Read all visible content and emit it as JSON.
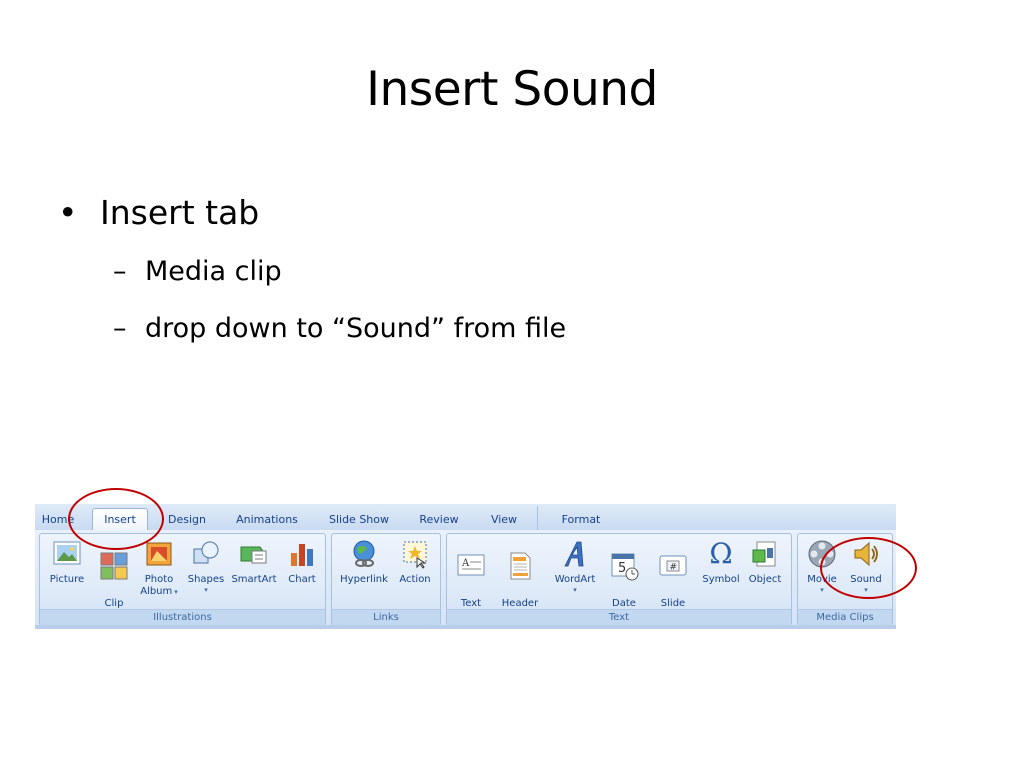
{
  "slide": {
    "title": "Insert Sound",
    "bullet": "Insert tab",
    "sub_bullets": [
      "Media clip",
      "drop down to “Sound” from file"
    ],
    "bullet_glyph": "•",
    "sub_glyph": "–"
  },
  "ribbon": {
    "tabs": [
      "Home",
      "Insert",
      "Design",
      "Animations",
      "Slide Show",
      "Review",
      "View",
      "Format"
    ],
    "active_tab": "Insert",
    "groups": {
      "illustrations": {
        "label": "Illustrations",
        "buttons": [
          {
            "label": "Picture",
            "icon": "picture-icon"
          },
          {
            "label": "Clip\nArt",
            "icon": "clip-art-icon"
          },
          {
            "label": "Photo\nAlbum",
            "icon": "photo-album-icon",
            "dropdown": true
          },
          {
            "label": "Shapes",
            "icon": "shapes-icon",
            "dropdown": true
          },
          {
            "label": "SmartArt",
            "icon": "smartart-icon"
          },
          {
            "label": "Chart",
            "icon": "chart-icon"
          }
        ]
      },
      "links": {
        "label": "Links",
        "buttons": [
          {
            "label": "Hyperlink",
            "icon": "hyperlink-icon"
          },
          {
            "label": "Action",
            "icon": "action-icon"
          }
        ]
      },
      "text": {
        "label": "Text",
        "buttons": [
          {
            "label": "Text\nBox",
            "icon": "text-box-icon"
          },
          {
            "label": "Header\n& Footer",
            "icon": "header-footer-icon"
          },
          {
            "label": "WordArt",
            "icon": "wordart-icon",
            "dropdown": true
          },
          {
            "label": "Date\n& Time",
            "icon": "date-time-icon"
          },
          {
            "label": "Slide\nNumber",
            "icon": "slide-number-icon"
          },
          {
            "label": "Symbol",
            "icon": "symbol-icon"
          },
          {
            "label": "Object",
            "icon": "object-icon"
          }
        ]
      },
      "media": {
        "label": "Media Clips",
        "buttons": [
          {
            "label": "Movie",
            "icon": "movie-icon",
            "dropdown": true
          },
          {
            "label": "Sound",
            "icon": "sound-icon",
            "dropdown": true
          }
        ]
      }
    },
    "glyphs": {
      "dropdown": "▾",
      "symbol": "Ω",
      "date_number": "5",
      "slide_number": "#",
      "text_box_letter": "A"
    }
  },
  "colors": {
    "callout": "#c00000",
    "ribbon_text": "#15428b",
    "ribbon_bg": "#d7e5f7"
  }
}
